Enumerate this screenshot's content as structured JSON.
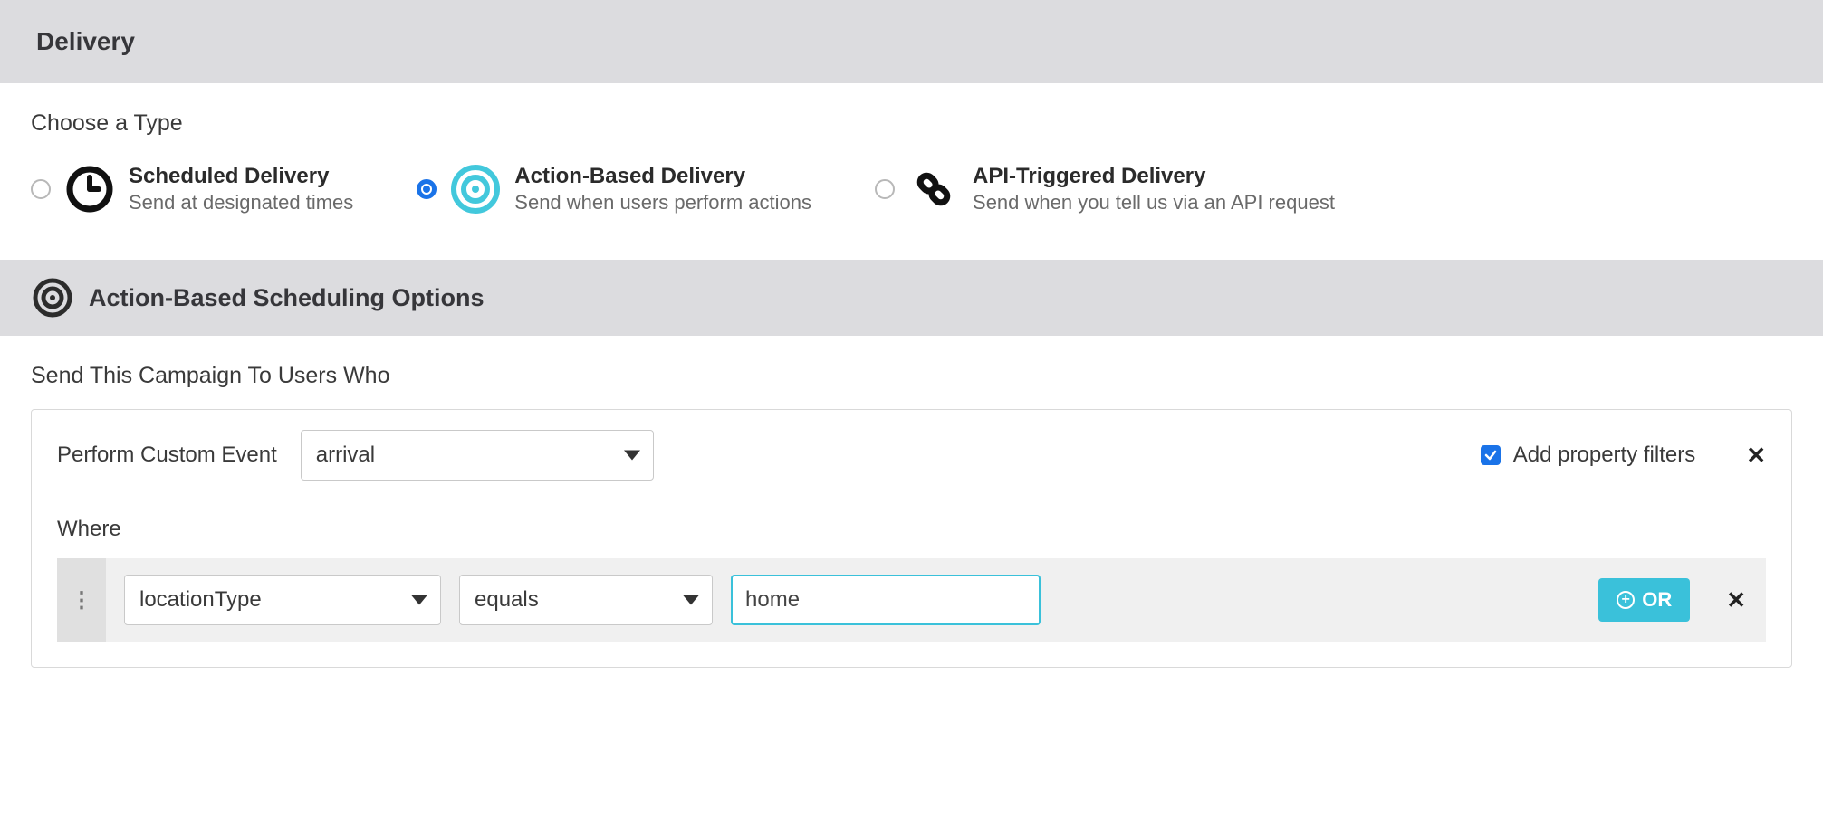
{
  "delivery": {
    "header_title": "Delivery",
    "choose_type_label": "Choose a Type",
    "types": {
      "scheduled": {
        "title": "Scheduled Delivery",
        "sub": "Send at designated times"
      },
      "action": {
        "title": "Action-Based Delivery",
        "sub": "Send when users perform actions"
      },
      "api": {
        "title": "API-Triggered Delivery",
        "sub": "Send when you tell us via an API request"
      }
    }
  },
  "scheduling": {
    "header_title": "Action-Based Scheduling Options",
    "send_to_label": "Send This Campaign To Users Who",
    "perform_label": "Perform Custom Event",
    "event_value": "arrival",
    "property_filters_label": "Add property filters",
    "where_label": "Where",
    "filter": {
      "property": "locationType",
      "operator": "equals",
      "value": "home"
    },
    "or_label": "OR"
  }
}
